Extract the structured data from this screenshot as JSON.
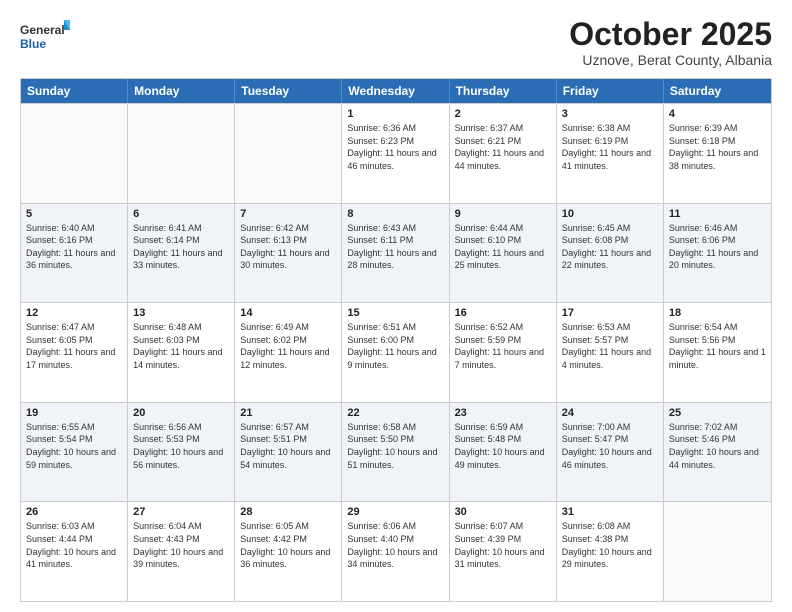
{
  "header": {
    "logo": {
      "general": "General",
      "blue": "Blue"
    },
    "title": "October 2025",
    "location": "Uznove, Berat County, Albania"
  },
  "calendar": {
    "days": [
      "Sunday",
      "Monday",
      "Tuesday",
      "Wednesday",
      "Thursday",
      "Friday",
      "Saturday"
    ],
    "weeks": [
      [
        {
          "day": "",
          "info": ""
        },
        {
          "day": "",
          "info": ""
        },
        {
          "day": "",
          "info": ""
        },
        {
          "day": "1",
          "info": "Sunrise: 6:36 AM\nSunset: 6:23 PM\nDaylight: 11 hours and 46 minutes."
        },
        {
          "day": "2",
          "info": "Sunrise: 6:37 AM\nSunset: 6:21 PM\nDaylight: 11 hours and 44 minutes."
        },
        {
          "day": "3",
          "info": "Sunrise: 6:38 AM\nSunset: 6:19 PM\nDaylight: 11 hours and 41 minutes."
        },
        {
          "day": "4",
          "info": "Sunrise: 6:39 AM\nSunset: 6:18 PM\nDaylight: 11 hours and 38 minutes."
        }
      ],
      [
        {
          "day": "5",
          "info": "Sunrise: 6:40 AM\nSunset: 6:16 PM\nDaylight: 11 hours and 36 minutes."
        },
        {
          "day": "6",
          "info": "Sunrise: 6:41 AM\nSunset: 6:14 PM\nDaylight: 11 hours and 33 minutes."
        },
        {
          "day": "7",
          "info": "Sunrise: 6:42 AM\nSunset: 6:13 PM\nDaylight: 11 hours and 30 minutes."
        },
        {
          "day": "8",
          "info": "Sunrise: 6:43 AM\nSunset: 6:11 PM\nDaylight: 11 hours and 28 minutes."
        },
        {
          "day": "9",
          "info": "Sunrise: 6:44 AM\nSunset: 6:10 PM\nDaylight: 11 hours and 25 minutes."
        },
        {
          "day": "10",
          "info": "Sunrise: 6:45 AM\nSunset: 6:08 PM\nDaylight: 11 hours and 22 minutes."
        },
        {
          "day": "11",
          "info": "Sunrise: 6:46 AM\nSunset: 6:06 PM\nDaylight: 11 hours and 20 minutes."
        }
      ],
      [
        {
          "day": "12",
          "info": "Sunrise: 6:47 AM\nSunset: 6:05 PM\nDaylight: 11 hours and 17 minutes."
        },
        {
          "day": "13",
          "info": "Sunrise: 6:48 AM\nSunset: 6:03 PM\nDaylight: 11 hours and 14 minutes."
        },
        {
          "day": "14",
          "info": "Sunrise: 6:49 AM\nSunset: 6:02 PM\nDaylight: 11 hours and 12 minutes."
        },
        {
          "day": "15",
          "info": "Sunrise: 6:51 AM\nSunset: 6:00 PM\nDaylight: 11 hours and 9 minutes."
        },
        {
          "day": "16",
          "info": "Sunrise: 6:52 AM\nSunset: 5:59 PM\nDaylight: 11 hours and 7 minutes."
        },
        {
          "day": "17",
          "info": "Sunrise: 6:53 AM\nSunset: 5:57 PM\nDaylight: 11 hours and 4 minutes."
        },
        {
          "day": "18",
          "info": "Sunrise: 6:54 AM\nSunset: 5:56 PM\nDaylight: 11 hours and 1 minute."
        }
      ],
      [
        {
          "day": "19",
          "info": "Sunrise: 6:55 AM\nSunset: 5:54 PM\nDaylight: 10 hours and 59 minutes."
        },
        {
          "day": "20",
          "info": "Sunrise: 6:56 AM\nSunset: 5:53 PM\nDaylight: 10 hours and 56 minutes."
        },
        {
          "day": "21",
          "info": "Sunrise: 6:57 AM\nSunset: 5:51 PM\nDaylight: 10 hours and 54 minutes."
        },
        {
          "day": "22",
          "info": "Sunrise: 6:58 AM\nSunset: 5:50 PM\nDaylight: 10 hours and 51 minutes."
        },
        {
          "day": "23",
          "info": "Sunrise: 6:59 AM\nSunset: 5:48 PM\nDaylight: 10 hours and 49 minutes."
        },
        {
          "day": "24",
          "info": "Sunrise: 7:00 AM\nSunset: 5:47 PM\nDaylight: 10 hours and 46 minutes."
        },
        {
          "day": "25",
          "info": "Sunrise: 7:02 AM\nSunset: 5:46 PM\nDaylight: 10 hours and 44 minutes."
        }
      ],
      [
        {
          "day": "26",
          "info": "Sunrise: 6:03 AM\nSunset: 4:44 PM\nDaylight: 10 hours and 41 minutes."
        },
        {
          "day": "27",
          "info": "Sunrise: 6:04 AM\nSunset: 4:43 PM\nDaylight: 10 hours and 39 minutes."
        },
        {
          "day": "28",
          "info": "Sunrise: 6:05 AM\nSunset: 4:42 PM\nDaylight: 10 hours and 36 minutes."
        },
        {
          "day": "29",
          "info": "Sunrise: 6:06 AM\nSunset: 4:40 PM\nDaylight: 10 hours and 34 minutes."
        },
        {
          "day": "30",
          "info": "Sunrise: 6:07 AM\nSunset: 4:39 PM\nDaylight: 10 hours and 31 minutes."
        },
        {
          "day": "31",
          "info": "Sunrise: 6:08 AM\nSunset: 4:38 PM\nDaylight: 10 hours and 29 minutes."
        },
        {
          "day": "",
          "info": ""
        }
      ]
    ]
  }
}
